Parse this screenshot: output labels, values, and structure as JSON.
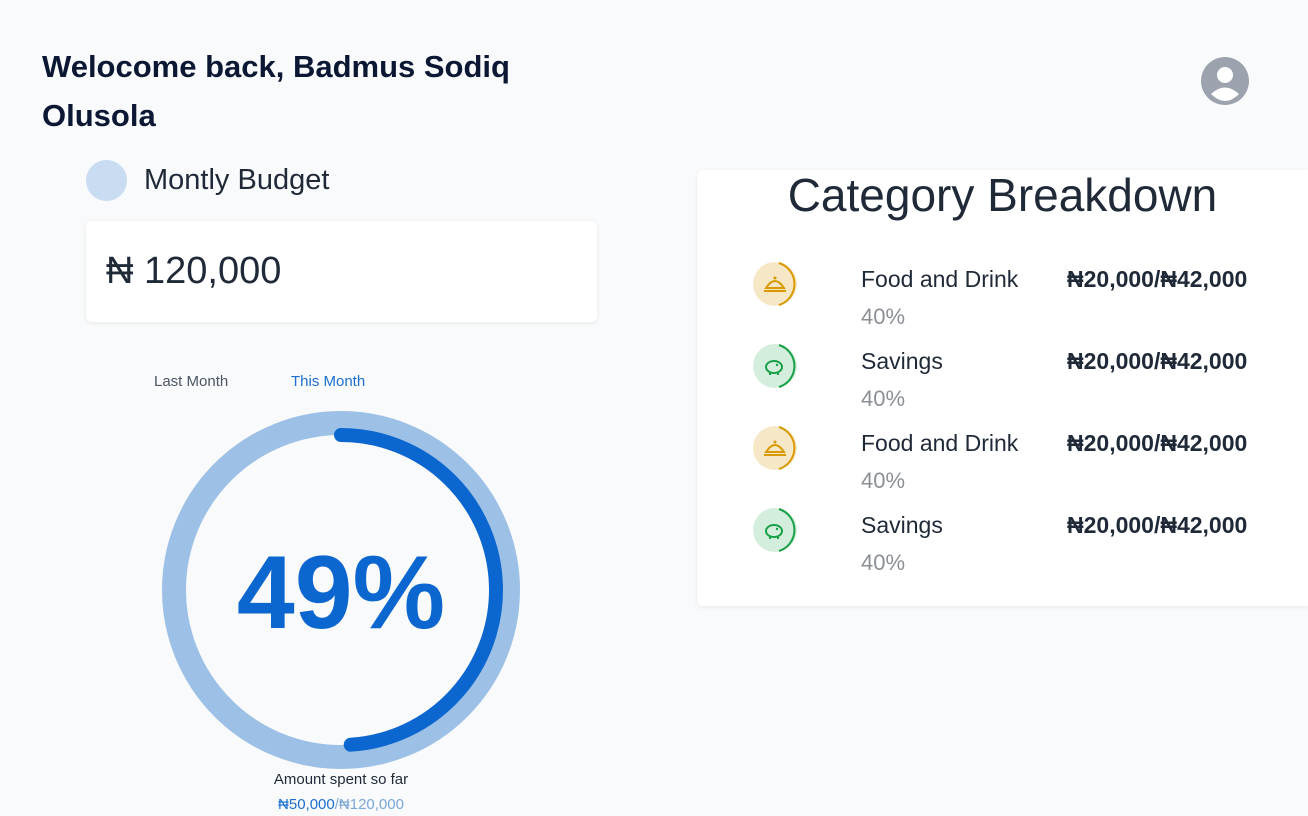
{
  "header": {
    "greeting": "Welocome back, Badmus Sodiq Olusola",
    "avatar_icon": "user-circle-icon"
  },
  "budget": {
    "label": "Montly Budget",
    "amount": "₦ 120,000",
    "dot_color": "#c9dcf2"
  },
  "tabs": [
    {
      "label": "Last Month",
      "active": false
    },
    {
      "label": "This Month",
      "active": true
    }
  ],
  "progress": {
    "percent_text": "49%",
    "fraction": 0.49,
    "caption": "Amount spent so far",
    "spent": "₦50,000",
    "total": "/₦120,000",
    "track_color": "#9dc0e6",
    "fill_color": "#0b67cf"
  },
  "categories": {
    "title": "Category Breakdown",
    "items": [
      {
        "name": "Food and Drink",
        "amount": "₦20,000/₦42,000",
        "percent": "40%",
        "icon": "food-cloche-icon",
        "bg": "#f6e7c6",
        "color": "#d99a00"
      },
      {
        "name": "Savings",
        "amount": "₦20,000/₦42,000",
        "percent": "40%",
        "icon": "piggy-bank-icon",
        "bg": "#d4eedd",
        "color": "#18a047"
      },
      {
        "name": "Food and Drink",
        "amount": "₦20,000/₦42,000",
        "percent": "40%",
        "icon": "food-cloche-icon",
        "bg": "#f6e7c6",
        "color": "#d99a00"
      },
      {
        "name": "Savings",
        "amount": "₦20,000/₦42,000",
        "percent": "40%",
        "icon": "piggy-bank-icon",
        "bg": "#d4eedd",
        "color": "#18a047"
      }
    ]
  }
}
